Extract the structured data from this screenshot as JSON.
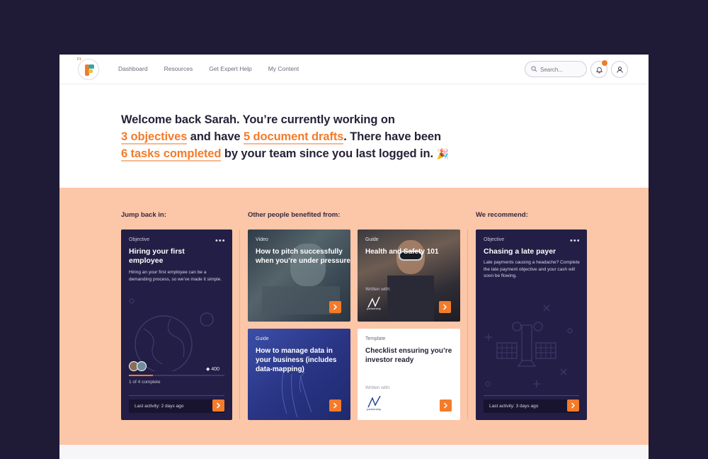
{
  "nav": {
    "logo_tag": "F1",
    "links": [
      "Dashboard",
      "Resources",
      "Get Expert Help",
      "My Content"
    ],
    "search_placeholder": "Search..."
  },
  "hero": {
    "part1": "Welcome back Sarah. You’re currently working on",
    "objectives": "3 objectives",
    "part2": " and have ",
    "drafts": "5 document drafts",
    "part3": ". There have been",
    "tasks": "6 tasks completed",
    "part4": " by your team since you last logged in.",
    "emoji": "🎉"
  },
  "sections": {
    "jump": "Jump back in:",
    "others": "Other people benefited from:",
    "recommend": "We recommend:"
  },
  "card_objective": {
    "kicker": "Objective",
    "title": "Hiring your first employee",
    "desc": "Hiring an your first employee can be a demanding process, so we’ve made it simple.",
    "points": "400",
    "progress_label": "1 of 4 complete",
    "progress_fraction": 0.25,
    "last_activity": "Last activity: 2 days ago"
  },
  "card_video": {
    "kicker": "Video",
    "title": "How to pitch successfully when you’re under pressure"
  },
  "card_guide1": {
    "kicker": "Guide",
    "title": "Health and Safety 101",
    "written": "Written with:"
  },
  "card_guide2": {
    "kicker": "Guide",
    "title": "How to manage data in your business (includes data-mapping)"
  },
  "card_template": {
    "kicker": "Template",
    "title": "Checklist ensuring you’re investor ready",
    "written": "Written with:"
  },
  "card_recommend": {
    "kicker": "Objective",
    "title": "Chasing a late payer",
    "desc": "Late payments causing a headache? Complete the late payment objective and your cash will soon be flowing.",
    "last_activity": "Last activity: 3 days ago"
  },
  "colors": {
    "accent": "#f47b2a",
    "dark_card": "#231e45",
    "peach": "#fcc6a8",
    "background": "#1f1a36"
  }
}
